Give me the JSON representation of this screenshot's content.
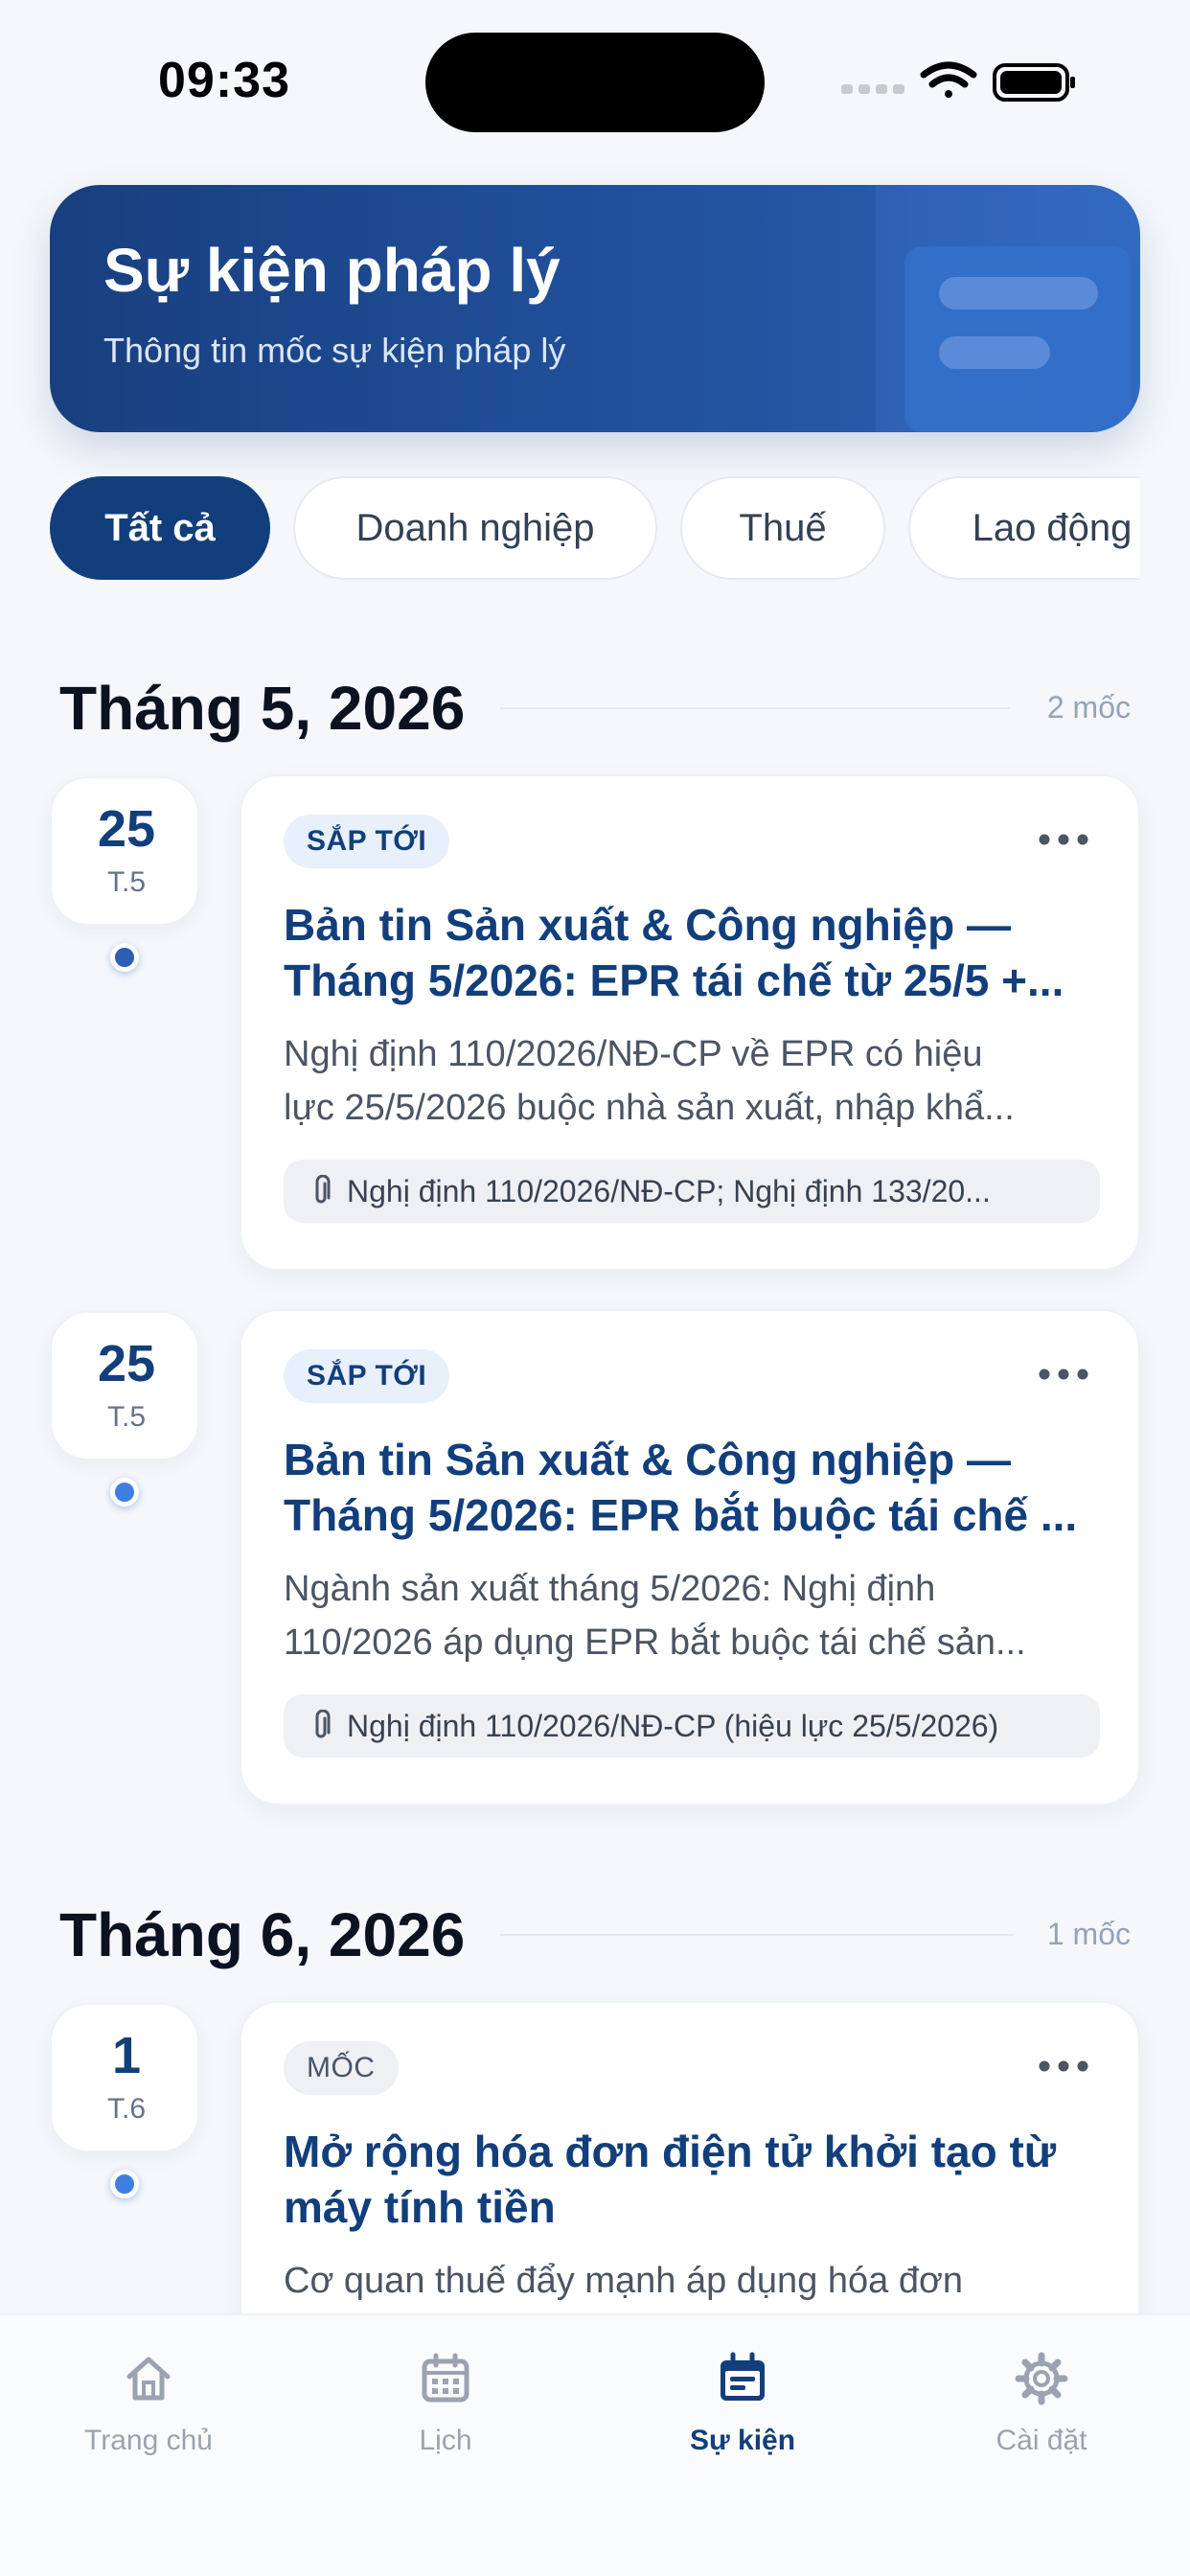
{
  "status_bar": {
    "time": "09:33"
  },
  "header": {
    "title": "Sự kiện pháp lý",
    "subtitle": "Thông tin mốc sự kiện pháp lý"
  },
  "filters": [
    {
      "label": "Tất cả",
      "active": true
    },
    {
      "label": "Doanh nghiệp",
      "active": false
    },
    {
      "label": "Thuế",
      "active": false
    },
    {
      "label": "Lao động",
      "active": false
    }
  ],
  "months": [
    {
      "title": "Tháng 5, 2026",
      "count": "2 mốc",
      "events": [
        {
          "day": "25",
          "month": "T.5",
          "tag": "SẮP TỚI",
          "title_lines": [
            "Bản tin Sản xuất & Công nghiệp —",
            "Tháng 5/2026: EPR tái chế từ 25/5 +..."
          ],
          "desc_lines": [
            "Nghị định 110/2026/NĐ-CP về EPR có hiệu",
            "lực 25/5/2026 buộc nhà sản xuất, nhập khẩ..."
          ],
          "attachment": "Nghị định 110/2026/NĐ-CP; Nghị định 133/20..."
        },
        {
          "day": "25",
          "month": "T.5",
          "tag": "SẮP TỚI",
          "title_lines": [
            "Bản tin Sản xuất & Công nghiệp —",
            "Tháng 5/2026: EPR bắt buộc tái chế ..."
          ],
          "desc_lines": [
            "Ngành sản xuất tháng 5/2026: Nghị định",
            "110/2026 áp dụng EPR bắt buộc tái chế sản..."
          ],
          "attachment": "Nghị định 110/2026/NĐ-CP (hiệu lực 25/5/2026)"
        }
      ]
    },
    {
      "title": "Tháng 6, 2026",
      "count": "1 mốc",
      "events": [
        {
          "day": "1",
          "month": "T.6",
          "tag": "MỐC",
          "title_lines": [
            "Mở rộng hóa đơn điện tử khởi tạo từ",
            "máy tính tiền"
          ],
          "desc_lines": [
            "Cơ quan thuế đẩy mạnh áp dụng hóa đơn"
          ]
        }
      ]
    }
  ],
  "tabbar": [
    {
      "label": "Trang chủ",
      "icon": "home-icon",
      "active": false
    },
    {
      "label": "Lịch",
      "icon": "calendar-icon",
      "active": false
    },
    {
      "label": "Sự kiện",
      "icon": "event-icon",
      "active": true
    },
    {
      "label": "Cài đặt",
      "icon": "gear-icon",
      "active": false
    }
  ],
  "colors": {
    "primary": "#123f7c",
    "accent": "#2c5fb3",
    "background": "#f5f7fb"
  }
}
